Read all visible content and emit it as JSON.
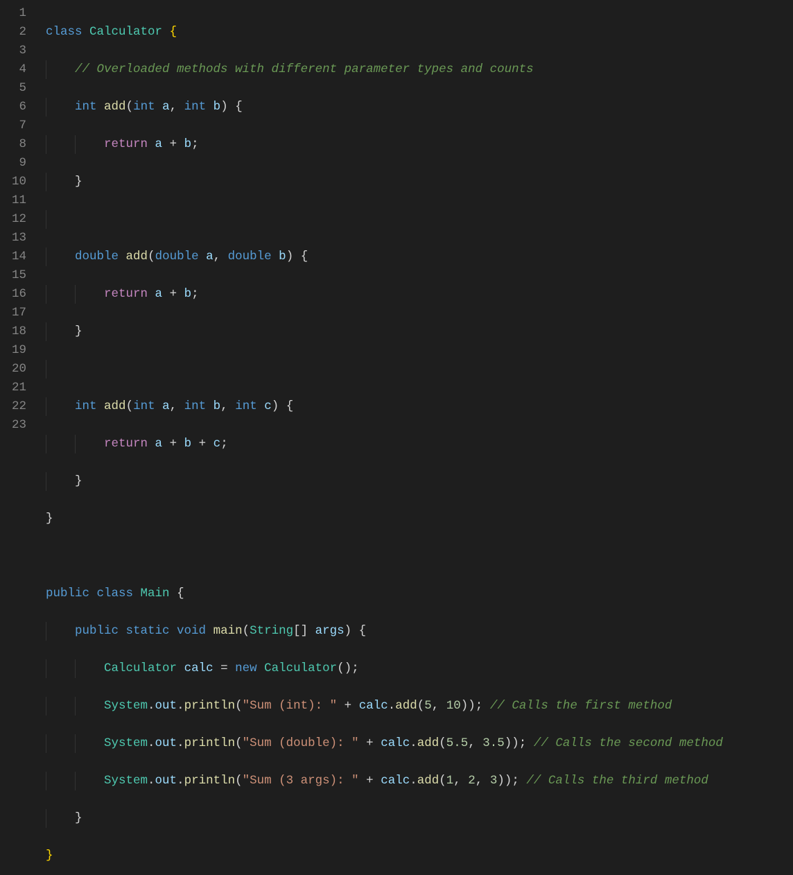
{
  "line_numbers": [
    "1",
    "2",
    "3",
    "4",
    "5",
    "6",
    "7",
    "8",
    "9",
    "10",
    "11",
    "12",
    "13",
    "14",
    "15",
    "16",
    "17",
    "18",
    "19",
    "20",
    "21",
    "22",
    "23"
  ],
  "code": {
    "l1": {
      "kw_class": "class",
      "cls": "Calculator",
      "ob": "{"
    },
    "l2": {
      "comment": "// Overloaded methods with different parameter types and counts"
    },
    "l3": {
      "ret": "int",
      "fn": "add",
      "p1t": "int",
      "p1": "a",
      "p2t": "int",
      "p2": "b",
      "ob": "{"
    },
    "l4": {
      "kw": "return",
      "a": "a",
      "op": "+",
      "b": "b",
      "semi": ";"
    },
    "l5": {
      "cb": "}"
    },
    "l7": {
      "ret": "double",
      "fn": "add",
      "p1t": "double",
      "p1": "a",
      "p2t": "double",
      "p2": "b",
      "ob": "{"
    },
    "l8": {
      "kw": "return",
      "a": "a",
      "op": "+",
      "b": "b",
      "semi": ";"
    },
    "l9": {
      "cb": "}"
    },
    "l11": {
      "ret": "int",
      "fn": "add",
      "p1t": "int",
      "p1": "a",
      "p2t": "int",
      "p2": "b",
      "p3t": "int",
      "p3": "c",
      "ob": "{"
    },
    "l12": {
      "kw": "return",
      "a": "a",
      "op1": "+",
      "b": "b",
      "op2": "+",
      "c": "c",
      "semi": ";"
    },
    "l13": {
      "cb": "}"
    },
    "l14": {
      "cb": "}"
    },
    "l16": {
      "mods": "public class",
      "cls": "Main",
      "ob": "{"
    },
    "l17": {
      "mods": "public static void",
      "fn": "main",
      "pt": "String",
      "br": "[]",
      "pn": "args",
      "ob": "{"
    },
    "l18": {
      "cls": "Calculator",
      "var": "calc",
      "eq": "=",
      "kw_new": "new",
      "ctor": "Calculator",
      "paren": "()",
      "semi": ";"
    },
    "l19": {
      "sys": "System",
      "out": "out",
      "fn": "println",
      "str": "\"Sum (int): \"",
      "plus": "+",
      "obj": "calc",
      "call": "add",
      "a1": "5",
      "a2": "10",
      "comment": "// Calls the first method"
    },
    "l20": {
      "sys": "System",
      "out": "out",
      "fn": "println",
      "str": "\"Sum (double): \"",
      "plus": "+",
      "obj": "calc",
      "call": "add",
      "a1": "5.5",
      "a2": "3.5",
      "comment": "// Calls the second method"
    },
    "l21": {
      "sys": "System",
      "out": "out",
      "fn": "println",
      "str": "\"Sum (3 args): \"",
      "plus": "+",
      "obj": "calc",
      "call": "add",
      "a1": "1",
      "a2": "2",
      "a3": "3",
      "comment": "// Calls the third method"
    },
    "l22": {
      "cb": "}"
    },
    "l23": {
      "cb": "}"
    }
  }
}
